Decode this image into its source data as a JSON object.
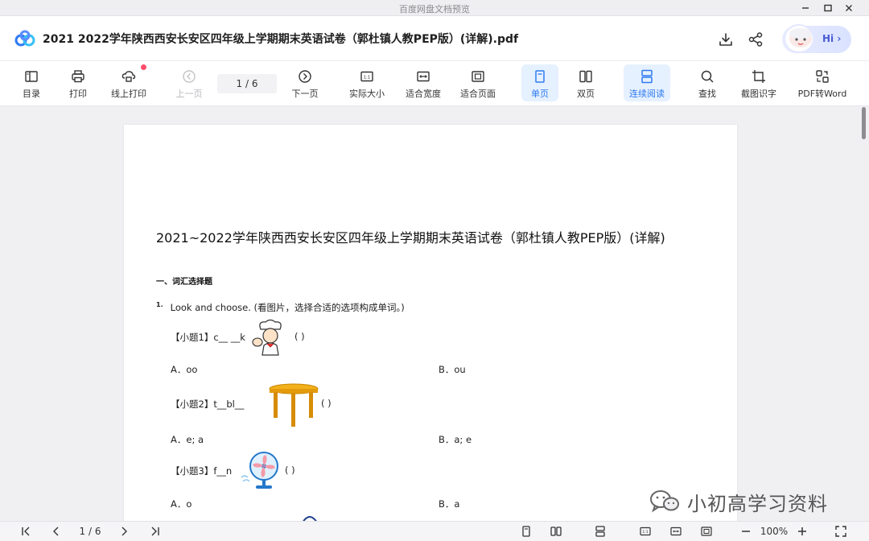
{
  "window": {
    "title": "百度网盘文档预览"
  },
  "header": {
    "doc_title": "2021  2022学年陕西西安长安区四年级上学期期末英语试卷（郭杜镇人教PEP版）(详解).pdf",
    "hi_label": "Hi ›"
  },
  "toolbar": {
    "toc": "目录",
    "print": "打印",
    "online_print": "线上打印",
    "prev": "上一页",
    "page_indicator": "1 / 6",
    "next": "下一页",
    "actual_size": "实际大小",
    "fit_width": "适合宽度",
    "fit_page": "适合页面",
    "single": "单页",
    "double": "双页",
    "continuous": "连续阅读",
    "find": "查找",
    "ocr": "截图识字",
    "pdf_to_word": "PDF转Word"
  },
  "document": {
    "title": "2021~2022学年陕西西安长安区四年级上学期期末英语试卷（郭杜镇人教PEP版）(详解)",
    "section": "一、词汇选择题",
    "q_number": "1.",
    "question": "Look and choose. (看图片，选择合适的选项构成单词。)",
    "items": [
      {
        "stem": "【小题1】c__ __k",
        "paren": "(    )",
        "a": "A．oo",
        "b": "B．ou"
      },
      {
        "stem": "【小题2】t__bl__",
        "paren": "(    )",
        "a": "A．e; a",
        "b": "B．a; e"
      },
      {
        "stem": "【小题3】f__n",
        "paren": "(    )",
        "a": "A．o",
        "b": "B．a"
      }
    ]
  },
  "watermark": {
    "text": "小初高学习资料"
  },
  "statusbar": {
    "page_indicator": "1 / 6",
    "zoom": "100%"
  },
  "colors": {
    "accent": "#2f7af2",
    "active_bg": "#e6f1ff",
    "badge": "#ff4d6a"
  }
}
